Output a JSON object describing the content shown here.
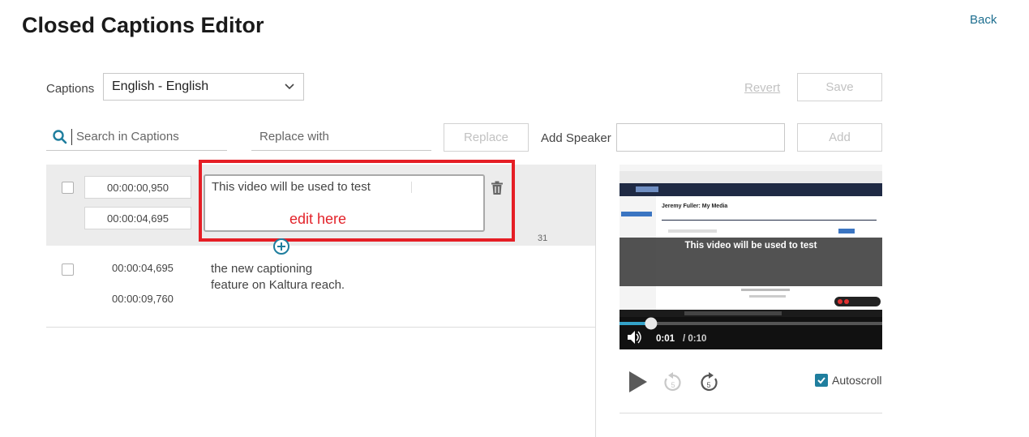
{
  "header": {
    "title": "Closed Captions Editor",
    "back_label": "Back"
  },
  "toolbar": {
    "captions_label": "Captions",
    "language_selected": "English - English",
    "revert_label": "Revert",
    "save_label": "Save"
  },
  "search": {
    "search_placeholder": "Search in Captions",
    "replace_placeholder": "Replace with",
    "replace_label": "Replace",
    "add_speaker_label": "Add Speaker",
    "add_label": "Add"
  },
  "captions": [
    {
      "start": "00:00:00,950",
      "end": "00:00:04,695",
      "text": "This video will be used to test",
      "char_count": "31",
      "annotation": "edit here"
    },
    {
      "start": "00:00:04,695",
      "end": "00:00:09,760",
      "text_line1": "the new captioning",
      "text_line2": "feature on Kaltura reach."
    }
  ],
  "player": {
    "subtitle": "This video will be used to test",
    "current_time": "0:01",
    "duration": "/ 0:10",
    "progress": 0.12,
    "screen_heading": "Jeremy Fuller: My Media"
  },
  "controls": {
    "rewind_seconds": "5",
    "forward_seconds": "5",
    "autoscroll_label": "Autoscroll",
    "autoscroll_checked": true
  },
  "colors": {
    "accent": "#1f7e9e",
    "annotation_red": "#e51e25",
    "link": "#1d6e8f"
  }
}
